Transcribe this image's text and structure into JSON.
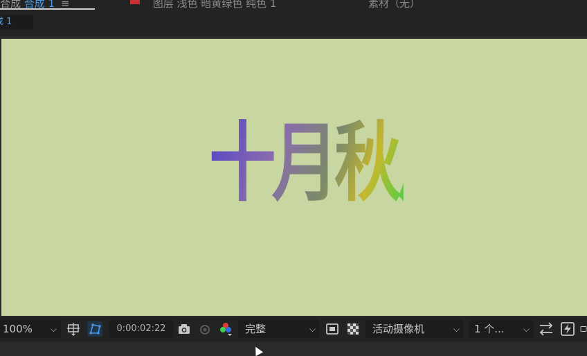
{
  "tabs": {
    "composition_label": "合成",
    "composition_name": "合成 1",
    "composition_menu": "≡",
    "layer_label": "图层 浅色 暗黄绿色 纯色 1",
    "footage_label": "素材（无）"
  },
  "breadcrumb": {
    "label": "成 1"
  },
  "canvas": {
    "text": "十月秋风"
  },
  "toolbar": {
    "zoom": "100%",
    "timecode": "0:00:02:22",
    "resolution": "完整",
    "camera": "活动摄像机",
    "views": "1 个..."
  },
  "colors": {
    "accent": "#4a9be8",
    "canvas_bg": "#c8d6a2",
    "layer_swatch": "#c8312f",
    "panel_bg": "#232323"
  }
}
